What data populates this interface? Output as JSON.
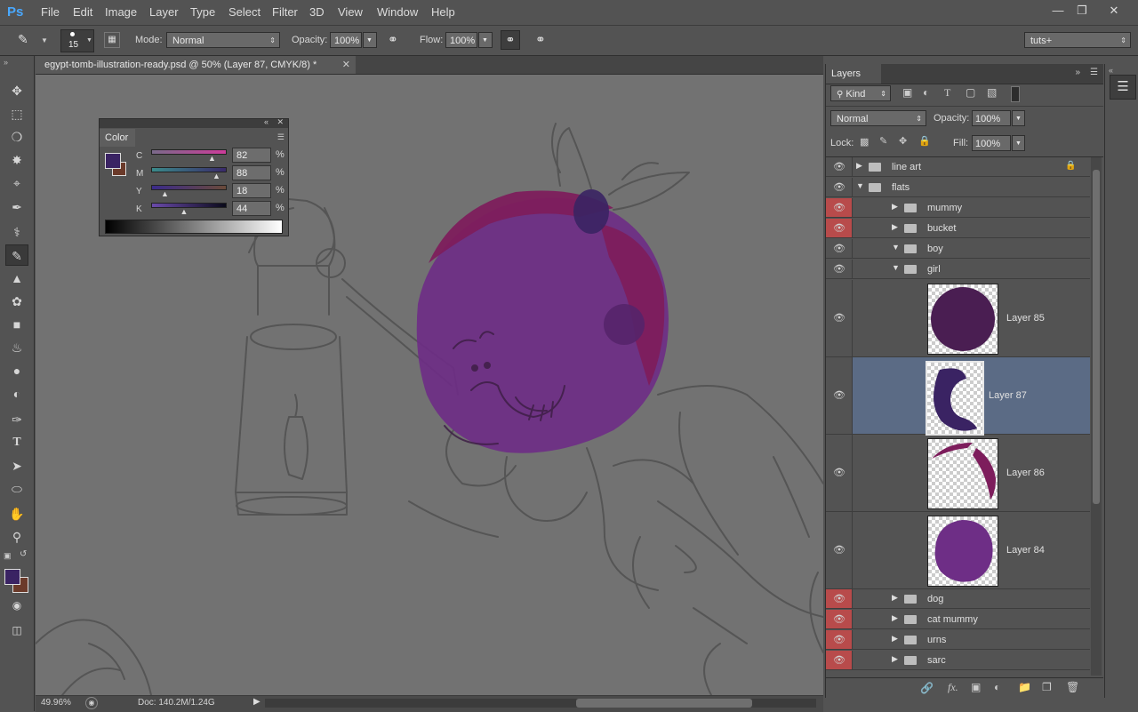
{
  "app": {
    "logo": "Ps"
  },
  "menu": [
    "File",
    "Edit",
    "Image",
    "Layer",
    "Type",
    "Select",
    "Filter",
    "3D",
    "View",
    "Window",
    "Help"
  ],
  "options": {
    "brush_size": "15",
    "mode_label": "Mode:",
    "mode_value": "Normal",
    "opacity_label": "Opacity:",
    "opacity_value": "100%",
    "flow_label": "Flow:",
    "flow_value": "100%",
    "workspace": "tuts+"
  },
  "document": {
    "tab_title": "egypt-tomb-illustration-ready.psd @ 50% (Layer 87, CMYK/8) *",
    "zoom": "49.96%",
    "doc_size": "Doc: 140.2M/1.24G"
  },
  "color_panel": {
    "title": "Color",
    "channels": [
      {
        "label": "C",
        "value": "82",
        "unit": "%",
        "level": 0.82
      },
      {
        "label": "M",
        "value": "88",
        "unit": "%",
        "level": 0.88
      },
      {
        "label": "Y",
        "value": "18",
        "unit": "%",
        "level": 0.18
      },
      {
        "label": "K",
        "value": "44",
        "unit": "%",
        "level": 0.44
      }
    ],
    "foreground": "#3a2363",
    "background": "#6b3a2a"
  },
  "layers_panel": {
    "title": "Layers",
    "kind_label": "Kind",
    "blend_mode": "Normal",
    "opacity_label": "Opacity:",
    "opacity_value": "100%",
    "lock_label": "Lock:",
    "fill_label": "Fill:",
    "fill_value": "100%",
    "rows": [
      {
        "name": "line art",
        "type": "group",
        "expanded": false,
        "red_eye": false,
        "locked": true,
        "indent": 0
      },
      {
        "name": "flats",
        "type": "group",
        "expanded": true,
        "red_eye": false,
        "locked": false,
        "indent": 0
      },
      {
        "name": "mummy",
        "type": "group",
        "expanded": false,
        "red_eye": true,
        "locked": false,
        "indent": 1
      },
      {
        "name": "bucket",
        "type": "group",
        "expanded": false,
        "red_eye": true,
        "locked": false,
        "indent": 1
      },
      {
        "name": "boy",
        "type": "group",
        "expanded": true,
        "red_eye": false,
        "locked": false,
        "indent": 1
      },
      {
        "name": "girl",
        "type": "group",
        "expanded": true,
        "red_eye": false,
        "locked": false,
        "indent": 1
      },
      {
        "name": "Layer 85",
        "type": "layer",
        "selected": false
      },
      {
        "name": "Layer 87",
        "type": "layer",
        "selected": true
      },
      {
        "name": "Layer 86",
        "type": "layer",
        "selected": false
      },
      {
        "name": "Layer 84",
        "type": "layer",
        "selected": false
      },
      {
        "name": "dog",
        "type": "group",
        "expanded": false,
        "red_eye": true,
        "locked": false,
        "indent": 1
      },
      {
        "name": "cat mummy",
        "type": "group",
        "expanded": false,
        "red_eye": true,
        "locked": false,
        "indent": 1
      },
      {
        "name": "urns",
        "type": "group",
        "expanded": false,
        "red_eye": true,
        "locked": false,
        "indent": 1
      },
      {
        "name": "sarc",
        "type": "group",
        "expanded": false,
        "red_eye": true,
        "locked": false,
        "indent": 1
      }
    ]
  },
  "colors": {
    "ui_gray": "#535353",
    "canvas_gray": "#727272",
    "selection": "#5b6b85",
    "red_eye": "#b84b4b",
    "purple_face": "#6e2e86",
    "magenta_hair": "#7d1d5c",
    "dark_purple": "#3a2363"
  }
}
